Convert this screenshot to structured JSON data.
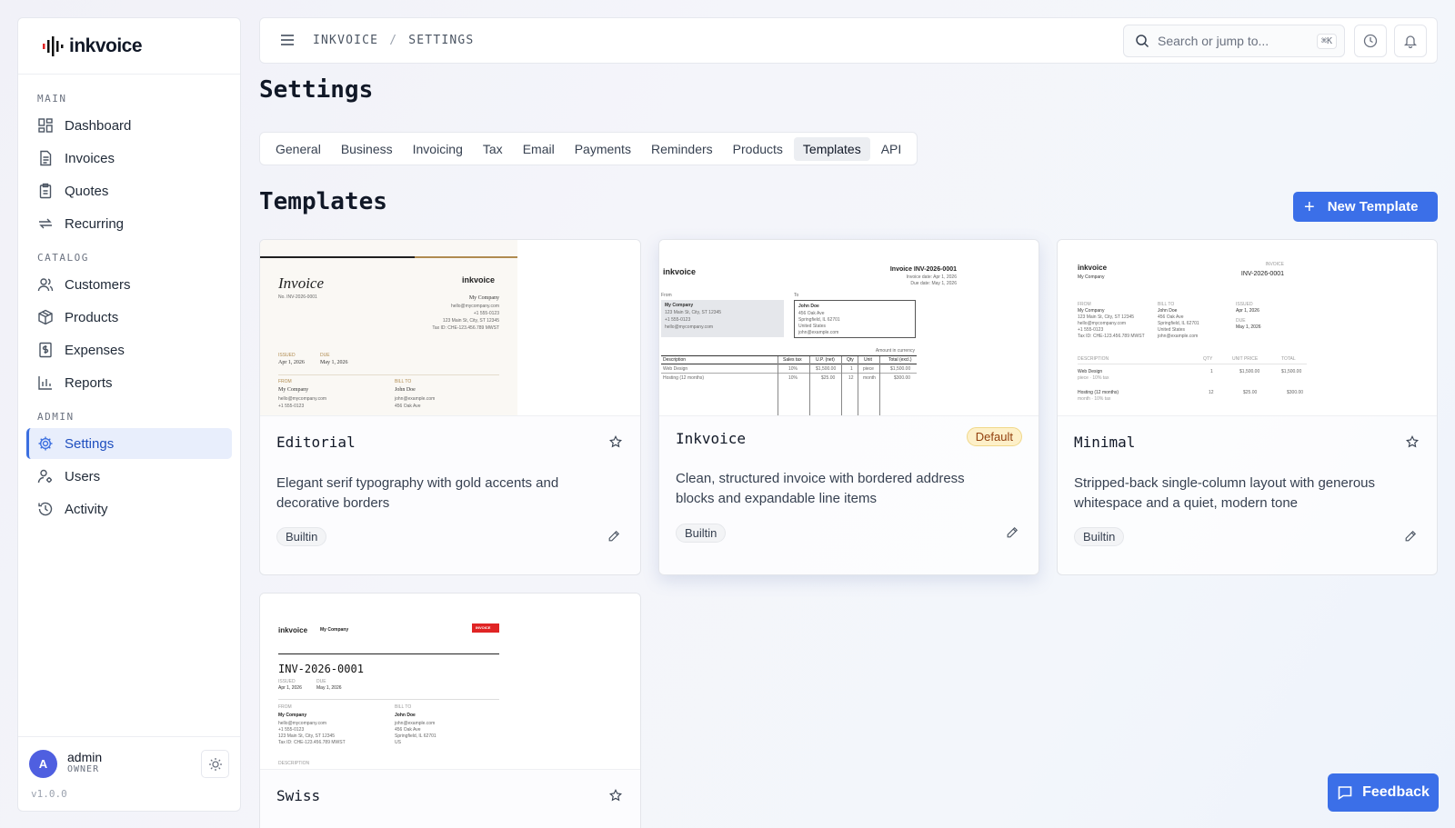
{
  "brand": {
    "name": "inkvoice"
  },
  "sidebar": {
    "sections": [
      {
        "title": "MAIN",
        "items": [
          {
            "label": "Dashboard",
            "icon": "dashboard-icon"
          },
          {
            "label": "Invoices",
            "icon": "file-text-icon"
          },
          {
            "label": "Quotes",
            "icon": "clipboard-icon"
          },
          {
            "label": "Recurring",
            "icon": "repeat-icon"
          }
        ]
      },
      {
        "title": "CATALOG",
        "items": [
          {
            "label": "Customers",
            "icon": "users-icon"
          },
          {
            "label": "Products",
            "icon": "package-icon"
          },
          {
            "label": "Expenses",
            "icon": "receipt-icon"
          },
          {
            "label": "Reports",
            "icon": "bar-chart-icon"
          }
        ]
      },
      {
        "title": "ADMIN",
        "items": [
          {
            "label": "Settings",
            "icon": "gear-icon",
            "active": true
          },
          {
            "label": "Users",
            "icon": "user-key-icon"
          },
          {
            "label": "Activity",
            "icon": "history-icon"
          }
        ]
      }
    ],
    "user": {
      "initial": "A",
      "name": "admin",
      "role": "OWNER"
    },
    "version": "v1.0.0"
  },
  "topbar": {
    "breadcrumb": [
      "INKVOICE",
      "SETTINGS"
    ],
    "search_placeholder": "Search or jump to...",
    "shortcut": "⌘K"
  },
  "page": {
    "title": "Settings",
    "tabs": [
      "General",
      "Business",
      "Invoicing",
      "Tax",
      "Email",
      "Payments",
      "Reminders",
      "Products",
      "Templates",
      "API"
    ],
    "active_tab": "Templates",
    "section_title": "Templates",
    "new_button": "New Template"
  },
  "templates": [
    {
      "name": "Editorial",
      "description": "Elegant serif typography with gold accents and decorative borders",
      "tag": "Builtin"
    },
    {
      "name": "Inkvoice",
      "description": "Clean, structured invoice with bordered address blocks and expandable line items",
      "tag": "Builtin",
      "badge": "Default"
    },
    {
      "name": "Minimal",
      "description": "Stripped-back single-column layout with generous whitespace and a quiet, modern tone",
      "tag": "Builtin"
    },
    {
      "name": "Swiss",
      "description": "",
      "tag": ""
    }
  ],
  "preview": {
    "invoice_word": "Invoice",
    "invoice_caps": "INVOICE",
    "invoice_number": "INV-2026-0001",
    "invoice_title": "Invoice INV-2026-0001",
    "no_line": "No. INV-2026-0001",
    "company": "My Company",
    "customer": "John Doe",
    "issue_date": "Apr 1, 2026",
    "due_date": "May 1, 2026",
    "issue_label": "ISSUED",
    "due_label": "DUE",
    "from_label": "FROM",
    "bill_to_label": "BILL TO",
    "from_label_short": "From",
    "to_label": "To",
    "issue_date_line": "Invoice date: Apr 1, 2026",
    "due_date_line": "Due date: May 1, 2026",
    "company_email": "hello@mycompany.com",
    "company_phone": "+1 555-0123",
    "company_address": "123 Main St, City, ST 12345",
    "company_vat": "Tax ID: CHE-123.456.789 MWST",
    "customer_email": "john@example.com",
    "customer_street": "456 Oak Ave",
    "customer_city": "Springfield, IL 62701",
    "customer_country": "United States",
    "customer_country_short": "US",
    "amount_currency": "Amount in currency",
    "table_headers": [
      "Description",
      "Sales tax",
      "U.P. (net)",
      "Qty",
      "Unit",
      "Total (excl.)"
    ],
    "rows": [
      {
        "desc": "Web Design",
        "tax": "10%",
        "price": "$1,500.00",
        "qty": "1",
        "unit": "piece",
        "total": "$1,500.00"
      },
      {
        "desc": "Hosting (12 months)",
        "tax": "10%",
        "price": "$25.00",
        "qty": "12",
        "unit": "month",
        "total": "$300.00"
      }
    ],
    "minimal_headers": [
      "DESCRIPTION",
      "QTY",
      "UNIT PRICE",
      "TOTAL"
    ],
    "minimal_rows": [
      {
        "desc": "Web Design",
        "note": "piece · 10% tax",
        "qty": "1",
        "price": "$1,500.00",
        "total": "$1,500.00"
      },
      {
        "desc": "Hosting (12 months)",
        "note": "month · 10% tax",
        "qty": "12",
        "price": "$25.00",
        "total": "$300.00"
      }
    ]
  },
  "feedback_label": "Feedback",
  "colors": {
    "accent": "#3b6fe8",
    "gold": "#b08b4f",
    "swiss_red": "#e02424",
    "default_badge": "#fdf0c9"
  }
}
